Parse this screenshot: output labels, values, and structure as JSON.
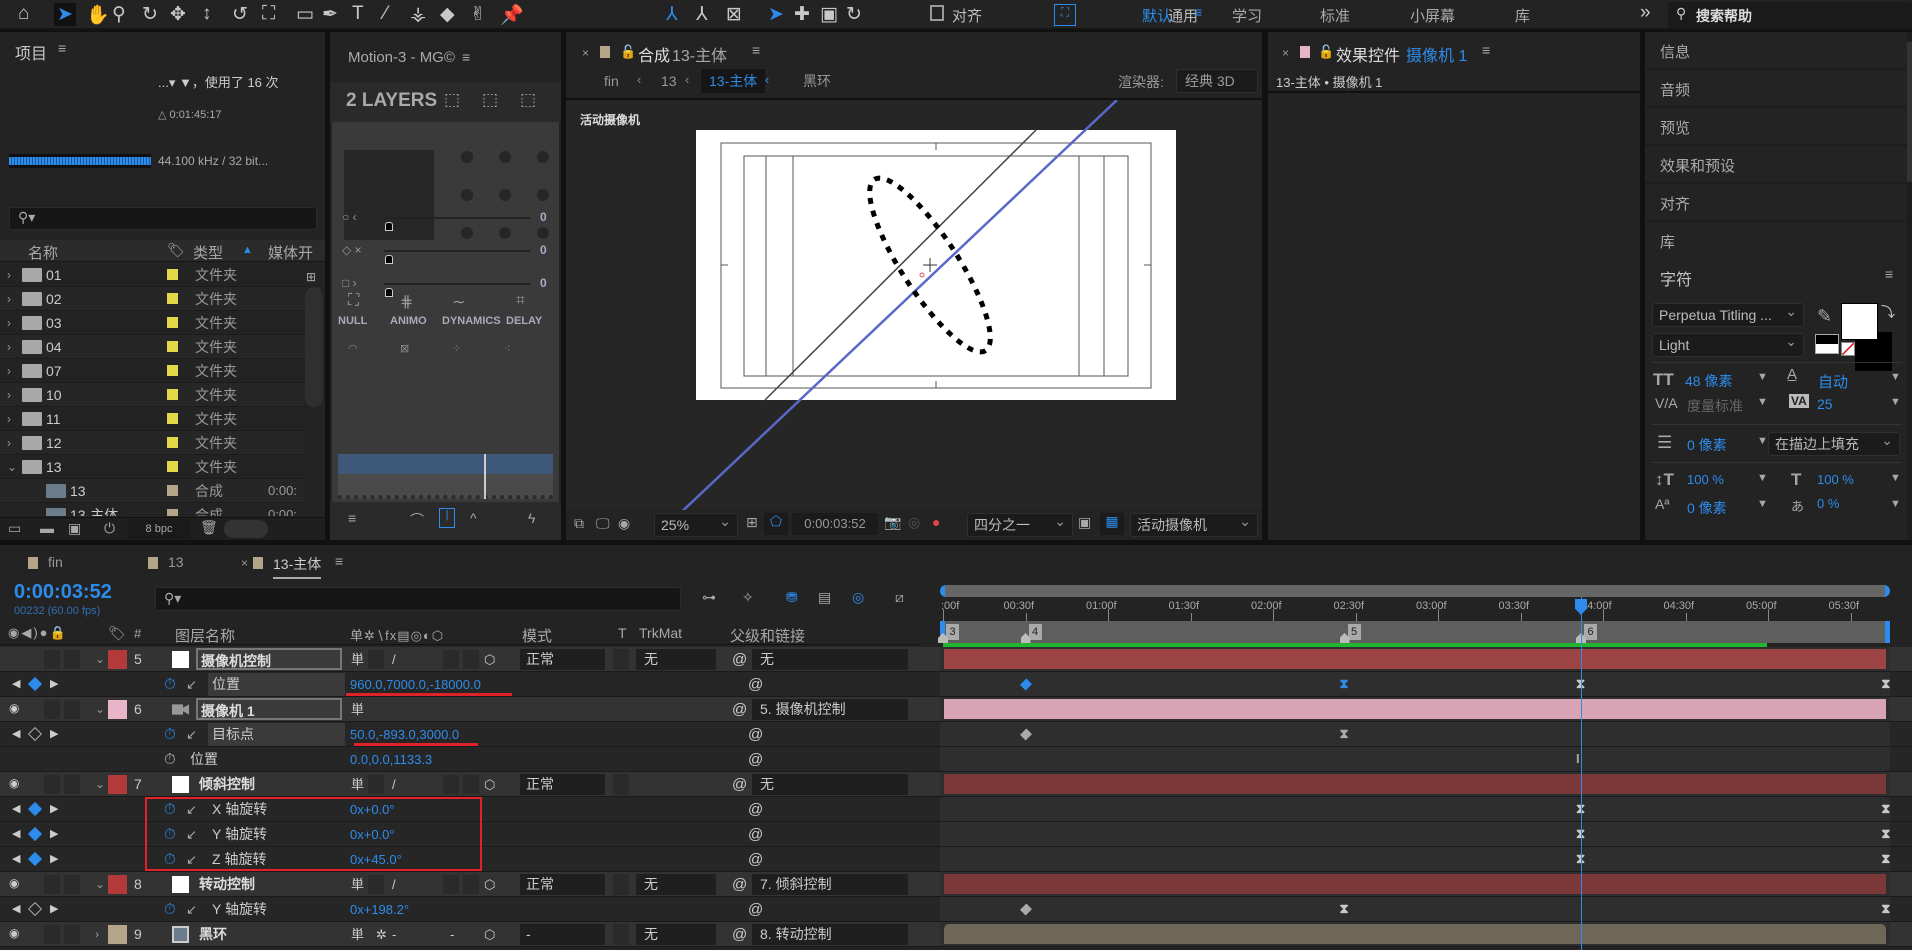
{
  "toolbar": {
    "tools": [
      "home-icon",
      "selection-arrow-icon",
      "hand-icon",
      "zoom-icon",
      "orbit-camera-icon",
      "pan-camera-icon",
      "dolly-camera-icon",
      "rotate-icon",
      "anchor-point-icon",
      "rectangle-icon",
      "pen-icon",
      "text-icon",
      "brush-icon",
      "clone-stamp-icon",
      "eraser-icon",
      "roto-brush-icon",
      "puppet-pin-icon"
    ],
    "axis_tools": [
      "local-axis-icon",
      "world-axis-icon",
      "view-axis-icon"
    ],
    "general_label": "通用",
    "align_label": "对齐",
    "workspaces": [
      "默认",
      "学习",
      "标准",
      "小屏幕",
      "库"
    ],
    "active_workspace": "默认",
    "more": "»",
    "search_placeholder": "搜索帮助"
  },
  "project": {
    "title": "项目",
    "usage": "...▾ ▼，使用了 16 次",
    "duration": "△ 0:01:45:17",
    "audio_info": "44.100 kHz / 32 bit...",
    "columns": {
      "name": "名称",
      "type": "类型",
      "media_start": "媒体开"
    },
    "rows": [
      {
        "name": "01",
        "kind": "folder",
        "type": "文件夹",
        "color": "#e3d84a",
        "expanded": false
      },
      {
        "name": "02",
        "kind": "folder",
        "type": "文件夹",
        "color": "#e3d84a",
        "expanded": false
      },
      {
        "name": "03",
        "kind": "folder",
        "type": "文件夹",
        "color": "#e3d84a",
        "expanded": false
      },
      {
        "name": "04",
        "kind": "folder",
        "type": "文件夹",
        "color": "#e3d84a",
        "expanded": false
      },
      {
        "name": "07",
        "kind": "folder",
        "type": "文件夹",
        "color": "#e3d84a",
        "expanded": false
      },
      {
        "name": "10",
        "kind": "folder",
        "type": "文件夹",
        "color": "#e3d84a",
        "expanded": false
      },
      {
        "name": "11",
        "kind": "folder",
        "type": "文件夹",
        "color": "#e3d84a",
        "expanded": false
      },
      {
        "name": "12",
        "kind": "folder",
        "type": "文件夹",
        "color": "#e3d84a",
        "expanded": false
      },
      {
        "name": "13",
        "kind": "folder",
        "type": "文件夹",
        "color": "#e3d84a",
        "expanded": true
      },
      {
        "name": "13",
        "kind": "comp",
        "type": "合成",
        "color": "#b5a588",
        "start": "0:00:"
      },
      {
        "name": "13-主体",
        "kind": "comp",
        "type": "合成",
        "color": "#b5a588",
        "start": "0:00:"
      }
    ],
    "bpc": "8 bpc"
  },
  "motion": {
    "title": "Motion-3 - MG©",
    "layers": "2 LAYERS",
    "sliders": [
      "0",
      "0",
      "0"
    ],
    "buttons": [
      "NULL",
      "ANIMO",
      "DYNAMICS",
      "DELAY"
    ]
  },
  "comp": {
    "tab_label": "合成",
    "comp_name": "13-主体",
    "breadcrumbs": [
      "fin",
      "13",
      "13-主体",
      "黑环"
    ],
    "active_breadcrumb": "13-主体",
    "renderer_label": "渲染器:",
    "renderer": "经典 3D",
    "view_label": "活动摄像机",
    "zoom": "25%",
    "timecode": "0:00:03:52",
    "resolution": "四分之一",
    "camera": "活动摄像机"
  },
  "effect": {
    "title": "效果控件",
    "target": "摄像机 1",
    "path": "13-主体 • 摄像机 1"
  },
  "right": {
    "panels": [
      "信息",
      "音频",
      "预览",
      "效果和预设",
      "对齐",
      "库"
    ],
    "character": {
      "title": "字符",
      "font": "Perpetua Titling ...",
      "style": "Light",
      "size": "48 像素",
      "leading": "自动",
      "kerning": "度量标准",
      "tracking": "25",
      "stroke_width": "0 像素",
      "stroke_mode": "在描边上填充",
      "vertical_scale": "100 %",
      "horizontal_scale": "100 %",
      "baseline_shift": "0 像素",
      "tsume": "0 %",
      "fill_color": "#ffffff",
      "stroke_color": "#000000"
    }
  },
  "timeline": {
    "tabs": [
      {
        "label": "fin",
        "color": "#b5a588"
      },
      {
        "label": "13",
        "color": "#b5a588"
      },
      {
        "label": "13-主体",
        "color": "#b5a588",
        "active": true
      }
    ],
    "timecode": "0:00:03:52",
    "frame_info": "00232 (60.00 fps)",
    "headers": {
      "num": "#",
      "name": "图层名称",
      "mode": "模式",
      "t": "T",
      "trkmat": "TrkMat",
      "parent": "父级和链接"
    },
    "ruler": [
      ":00f",
      "00:30f",
      "01:00f",
      "01:30f",
      "02:00f",
      "02:30f",
      "03:00f",
      "03:30f",
      "04:00f",
      "04:30f",
      "05:00f",
      "05:30f"
    ],
    "current_frame": 232,
    "markers": [
      {
        "label": "3",
        "frame": 0
      },
      {
        "label": "4",
        "frame": 30
      },
      {
        "label": "5",
        "frame": 146
      },
      {
        "label": "6",
        "frame": 232
      }
    ],
    "rows": [
      {
        "type": "layer",
        "num": "5",
        "color": "#b33a3a",
        "name": "摄像机控制",
        "boxed": true,
        "icon": "solid",
        "mode": "正常",
        "trkmat": "无",
        "parent": "无",
        "bar": "#9c4444",
        "eye": false
      },
      {
        "type": "prop",
        "name": "位置",
        "value": "960.0,7000.0,-18000.0",
        "boxed": true,
        "graph": true,
        "nav": "blue",
        "underline": true,
        "keys": [
          {
            "f": 30,
            "s": "diamond",
            "c": "#2d8ceb"
          },
          {
            "f": 146,
            "s": "hourglass",
            "c": "#2d8ceb"
          },
          {
            "f": 232,
            "s": "hourglass",
            "c": "#c8c8c8"
          },
          {
            "f": 343,
            "s": "hourglass",
            "c": "#c8c8c8"
          }
        ]
      },
      {
        "type": "layer",
        "num": "6",
        "color": "#e8b4c8",
        "name": "摄像机 1",
        "boxed": true,
        "icon": "camera",
        "parent": "5. 摄像机控制",
        "bar": "#d9a3b6",
        "eye": true
      },
      {
        "type": "prop",
        "name": "目标点",
        "value": "50.0,-893.0,3000.0",
        "boxed": true,
        "graph": true,
        "nav": "gray",
        "underline": true,
        "keys": [
          {
            "f": 30,
            "s": "diamond",
            "c": "#aaaaaa"
          },
          {
            "f": 146,
            "s": "hourglass",
            "c": "#aaaaaa"
          }
        ]
      },
      {
        "type": "prop",
        "name": "位置",
        "value": "0.0,0.0,1133.3",
        "graph": false,
        "keys": [
          {
            "f": 232,
            "s": "ibeam",
            "c": "#aaaaaa"
          }
        ]
      },
      {
        "type": "layer",
        "num": "7",
        "color": "#b33a3a",
        "name": "倾斜控制",
        "icon": "solid",
        "mode": "正常",
        "parent": "无",
        "bar": "#7a3838",
        "eye": true
      },
      {
        "type": "prop",
        "name": "X 轴旋转",
        "value": "0x+0.0°",
        "graph": true,
        "nav": "blue",
        "keys": [
          {
            "f": 232,
            "s": "hourglass",
            "c": "#c8c8c8"
          },
          {
            "f": 343,
            "s": "hourglass",
            "c": "#c8c8c8"
          }
        ]
      },
      {
        "type": "prop",
        "name": "Y 轴旋转",
        "value": "0x+0.0°",
        "graph": true,
        "nav": "blue",
        "keys": [
          {
            "f": 232,
            "s": "hourglass",
            "c": "#c8c8c8"
          },
          {
            "f": 343,
            "s": "hourglass",
            "c": "#c8c8c8"
          }
        ]
      },
      {
        "type": "prop",
        "name": "Z 轴旋转",
        "value": "0x+45.0°",
        "graph": true,
        "nav": "blue",
        "keys": [
          {
            "f": 232,
            "s": "hourglass",
            "c": "#c8c8c8"
          },
          {
            "f": 343,
            "s": "hourglass",
            "c": "#c8c8c8"
          }
        ]
      },
      {
        "type": "layer",
        "num": "8",
        "color": "#b33a3a",
        "name": "转动控制",
        "icon": "solid",
        "mode": "正常",
        "trkmat": "无",
        "parent": "7. 倾斜控制",
        "bar": "#7a3838",
        "eye": true
      },
      {
        "type": "prop",
        "name": "Y 轴旋转",
        "value": "0x+198.2°",
        "graph": true,
        "nav": "gray",
        "keys": [
          {
            "f": 30,
            "s": "diamond",
            "c": "#aaaaaa"
          },
          {
            "f": 146,
            "s": "hourglass",
            "c": "#c8c8c8"
          },
          {
            "f": 343,
            "s": "hourglass",
            "c": "#c8c8c8"
          }
        ]
      },
      {
        "type": "layer",
        "num": "9",
        "color": "#b5a588",
        "name": "黑环",
        "icon": "comp",
        "mode": "-",
        "trkmat": "无",
        "parent": "8. 转动控制",
        "bar": "#6e6656",
        "eye": true
      }
    ]
  },
  "colors": {
    "accent": "#2d8ceb",
    "highlight_box": "#e0232b",
    "work_area": "#22b532"
  }
}
